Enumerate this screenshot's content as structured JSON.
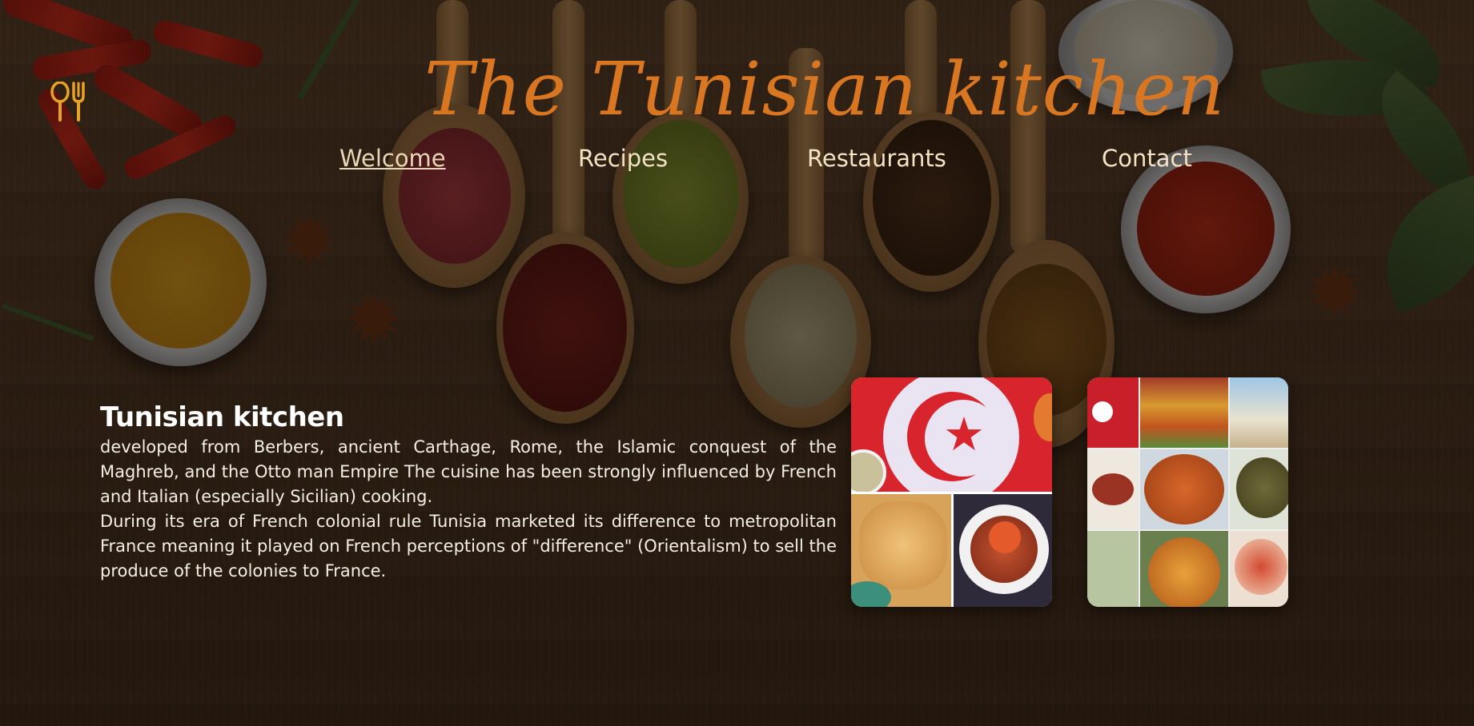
{
  "site": {
    "title": "The Tunisian kitchen"
  },
  "nav": {
    "items": [
      {
        "label": "Welcome",
        "active": true
      },
      {
        "label": "Recipes",
        "active": false
      },
      {
        "label": "Restaurants",
        "active": false
      },
      {
        "label": "Contact",
        "active": false
      }
    ]
  },
  "intro": {
    "heading": "Tunisian kitchen",
    "paragraph1": "developed from Berbers, ancient Carthage, Rome, the Islamic conquest of the Maghreb, and the Otto man Empire The cuisine has been strongly influenced by French and Italian (especially Sicilian) cooking.",
    "paragraph2": "During its era of French colonial rule Tunisia marketed its difference to metropolitan France meaning it played on French perceptions of \"difference\" (Orientalism) to sell the produce of the colonies to France."
  },
  "images": {
    "collage1": "tunisian-flag-and-dishes-collage",
    "collage2": "tunisian-spices-and-food-collage"
  },
  "icons": {
    "logo": "spoon-fork-icon"
  },
  "colors": {
    "title": "#d97621",
    "nav_text": "#f3e2c4",
    "body_text": "#ffffff",
    "logo": "#e8a325"
  }
}
